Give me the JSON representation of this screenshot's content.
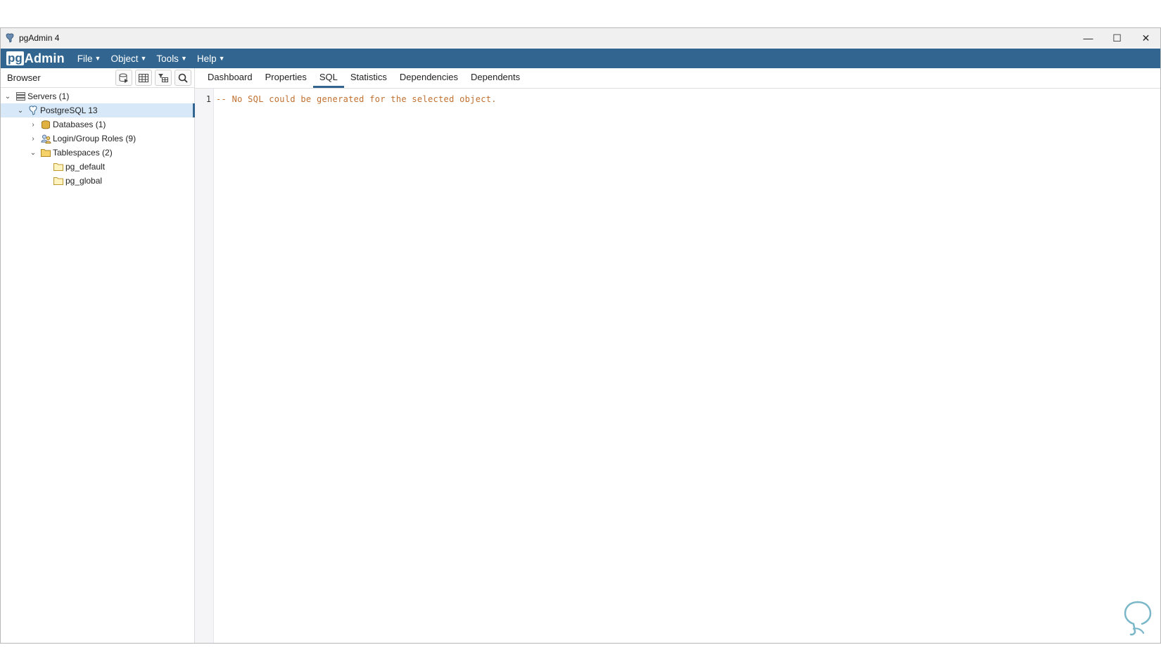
{
  "window": {
    "title": "pgAdmin 4",
    "controls": {
      "minimize": "—",
      "maximize": "☐",
      "close": "✕"
    }
  },
  "menubar": {
    "logo_pg": "pg",
    "logo_admin": "Admin",
    "menus": [
      {
        "label": "File"
      },
      {
        "label": "Object"
      },
      {
        "label": "Tools"
      },
      {
        "label": "Help"
      }
    ]
  },
  "browser": {
    "title": "Browser",
    "tree": [
      {
        "label": "Servers (1)",
        "icon": "servers-icon",
        "expanded": true
      },
      {
        "label": "PostgreSQL 13",
        "icon": "postgresql-icon",
        "expanded": true,
        "selected": true
      },
      {
        "label": "Databases (1)",
        "icon": "database-icon",
        "expanded": false
      },
      {
        "label": "Login/Group Roles (9)",
        "icon": "roles-icon",
        "expanded": false
      },
      {
        "label": "Tablespaces (2)",
        "icon": "folder-icon",
        "expanded": true
      },
      {
        "label": "pg_default",
        "icon": "folder-icon"
      },
      {
        "label": "pg_global",
        "icon": "folder-icon"
      }
    ]
  },
  "tabs": [
    {
      "label": "Dashboard"
    },
    {
      "label": "Properties"
    },
    {
      "label": "SQL",
      "active": true
    },
    {
      "label": "Statistics"
    },
    {
      "label": "Dependencies"
    },
    {
      "label": "Dependents"
    }
  ],
  "editor": {
    "line_number": "1",
    "code": "-- No SQL could be generated for the selected object."
  },
  "colors": {
    "brand": "#326690",
    "comment": "#c07030",
    "selection": "#d7e8f8"
  }
}
